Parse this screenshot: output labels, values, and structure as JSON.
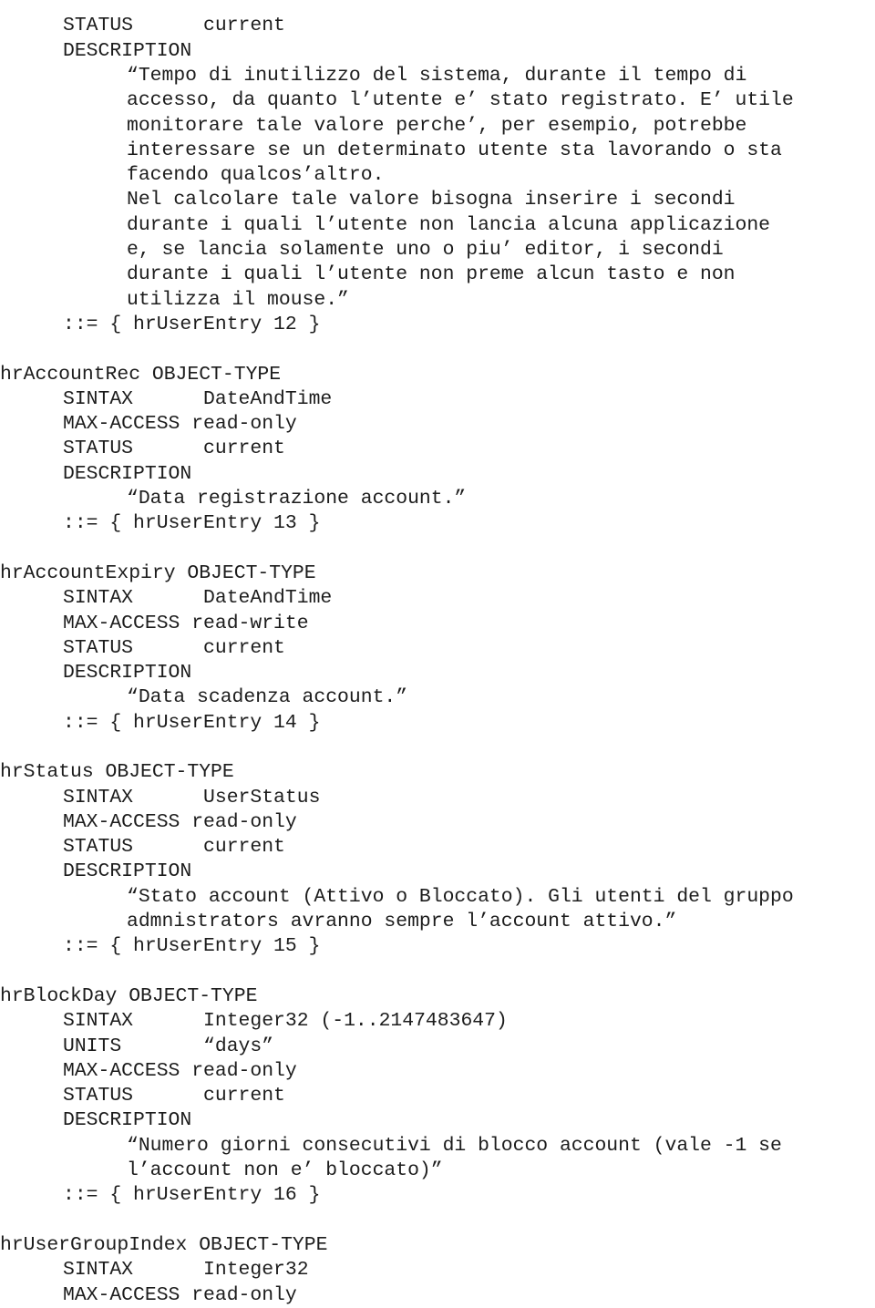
{
  "document": {
    "kind": "snmp-mib-definition-page",
    "language": "it",
    "lines": [
      {
        "id": "l01",
        "indent": "i5",
        "text": "STATUS      current"
      },
      {
        "id": "l02",
        "indent": "i5",
        "text": "DESCRIPTION"
      },
      {
        "id": "l03",
        "indent": "i10",
        "text": "“Tempo di inutilizzo del sistema, durante il tempo di"
      },
      {
        "id": "l04",
        "indent": "i10",
        "text": "accesso, da quanto l’utente e’ stato registrato. E’ utile"
      },
      {
        "id": "l05",
        "indent": "i10",
        "text": "monitorare tale valore perche’, per esempio, potrebbe"
      },
      {
        "id": "l06",
        "indent": "i10",
        "text": "interessare se un determinato utente sta lavorando o sta"
      },
      {
        "id": "l07",
        "indent": "i10",
        "text": "facendo qualcos’altro."
      },
      {
        "id": "l08",
        "indent": "i10",
        "text": "Nel calcolare tale valore bisogna inserire i secondi"
      },
      {
        "id": "l09",
        "indent": "i10",
        "text": "durante i quali l’utente non lancia alcuna applicazione"
      },
      {
        "id": "l10",
        "indent": "i10",
        "text": "e, se lancia solamente uno o piu’ editor, i secondi"
      },
      {
        "id": "l11",
        "indent": "i10",
        "text": "durante i quali l’utente non preme alcun tasto e non"
      },
      {
        "id": "l12",
        "indent": "i10",
        "text": "utilizza il mouse.”"
      },
      {
        "id": "l13",
        "indent": "i5",
        "text": "::= { hrUserEntry 12 }"
      },
      {
        "id": "l14",
        "indent": "i0",
        "text": ""
      },
      {
        "id": "l15",
        "indent": "i0",
        "text": "hrAccountRec OBJECT-TYPE"
      },
      {
        "id": "l16",
        "indent": "i5",
        "text": "SINTAX      DateAndTime"
      },
      {
        "id": "l17",
        "indent": "i5",
        "text": "MAX-ACCESS read-only"
      },
      {
        "id": "l18",
        "indent": "i5",
        "text": "STATUS      current"
      },
      {
        "id": "l19",
        "indent": "i5",
        "text": "DESCRIPTION"
      },
      {
        "id": "l20",
        "indent": "i10",
        "text": "“Data registrazione account.”"
      },
      {
        "id": "l21",
        "indent": "i5",
        "text": "::= { hrUserEntry 13 }"
      },
      {
        "id": "l22",
        "indent": "i0",
        "text": ""
      },
      {
        "id": "l23",
        "indent": "i0",
        "text": "hrAccountExpiry OBJECT-TYPE"
      },
      {
        "id": "l24",
        "indent": "i5",
        "text": "SINTAX      DateAndTime"
      },
      {
        "id": "l25",
        "indent": "i5",
        "text": "MAX-ACCESS read-write"
      },
      {
        "id": "l26",
        "indent": "i5",
        "text": "STATUS      current"
      },
      {
        "id": "l27",
        "indent": "i5",
        "text": "DESCRIPTION"
      },
      {
        "id": "l28",
        "indent": "i10",
        "text": "“Data scadenza account.”"
      },
      {
        "id": "l29",
        "indent": "i5",
        "text": "::= { hrUserEntry 14 }"
      },
      {
        "id": "l30",
        "indent": "i0",
        "text": ""
      },
      {
        "id": "l31",
        "indent": "i0",
        "text": "hrStatus OBJECT-TYPE"
      },
      {
        "id": "l32",
        "indent": "i5",
        "text": "SINTAX      UserStatus"
      },
      {
        "id": "l33",
        "indent": "i5",
        "text": "MAX-ACCESS read-only"
      },
      {
        "id": "l34",
        "indent": "i5",
        "text": "STATUS      current"
      },
      {
        "id": "l35",
        "indent": "i5",
        "text": "DESCRIPTION"
      },
      {
        "id": "l36",
        "indent": "i10",
        "text": "“Stato account (Attivo o Bloccato). Gli utenti del gruppo"
      },
      {
        "id": "l37",
        "indent": "i10",
        "text": "admnistrators avranno sempre l’account attivo.”"
      },
      {
        "id": "l38",
        "indent": "i5",
        "text": "::= { hrUserEntry 15 }"
      },
      {
        "id": "l39",
        "indent": "i0",
        "text": ""
      },
      {
        "id": "l40",
        "indent": "i0",
        "text": "hrBlockDay OBJECT-TYPE"
      },
      {
        "id": "l41",
        "indent": "i5",
        "text": "SINTAX      Integer32 (-1..2147483647)"
      },
      {
        "id": "l42",
        "indent": "i5",
        "text": "UNITS       “days”"
      },
      {
        "id": "l43",
        "indent": "i5",
        "text": "MAX-ACCESS read-only"
      },
      {
        "id": "l44",
        "indent": "i5",
        "text": "STATUS      current"
      },
      {
        "id": "l45",
        "indent": "i5",
        "text": "DESCRIPTION"
      },
      {
        "id": "l46",
        "indent": "i10",
        "text": "“Numero giorni consecutivi di blocco account (vale -1 se"
      },
      {
        "id": "l47",
        "indent": "i10",
        "text": "l’account non e’ bloccato)”"
      },
      {
        "id": "l48",
        "indent": "i5",
        "text": "::= { hrUserEntry 16 }"
      },
      {
        "id": "l49",
        "indent": "i0",
        "text": ""
      },
      {
        "id": "l50",
        "indent": "i0",
        "text": "hrUserGroupIndex OBJECT-TYPE"
      },
      {
        "id": "l51",
        "indent": "i5",
        "text": "SINTAX      Integer32"
      },
      {
        "id": "l52",
        "indent": "i5",
        "text": "MAX-ACCESS read-only"
      }
    ],
    "objects": [
      {
        "name": "hrAccountRec",
        "macro": "OBJECT-TYPE",
        "sintax": "DateAndTime",
        "max_access": "read-only",
        "status": "current",
        "description": "“Data registrazione account.”",
        "assignment": "::= { hrUserEntry 13 }"
      },
      {
        "name": "hrAccountExpiry",
        "macro": "OBJECT-TYPE",
        "sintax": "DateAndTime",
        "max_access": "read-write",
        "status": "current",
        "description": "“Data scadenza account.”",
        "assignment": "::= { hrUserEntry 14 }"
      },
      {
        "name": "hrStatus",
        "macro": "OBJECT-TYPE",
        "sintax": "UserStatus",
        "max_access": "read-only",
        "status": "current",
        "description": "“Stato account (Attivo o Bloccato). Gli utenti del gruppo admnistrators avranno sempre l’account attivo.”",
        "assignment": "::= { hrUserEntry 15 }"
      },
      {
        "name": "hrBlockDay",
        "macro": "OBJECT-TYPE",
        "sintax": "Integer32 (-1..2147483647)",
        "units": "“days”",
        "max_access": "read-only",
        "status": "current",
        "description": "“Numero giorni consecutivi di blocco account (vale -1 se l’account non e’ bloccato)”",
        "assignment": "::= { hrUserEntry 16 }"
      },
      {
        "name": "hrUserGroupIndex",
        "macro": "OBJECT-TYPE",
        "sintax": "Integer32",
        "max_access": "read-only"
      }
    ]
  }
}
